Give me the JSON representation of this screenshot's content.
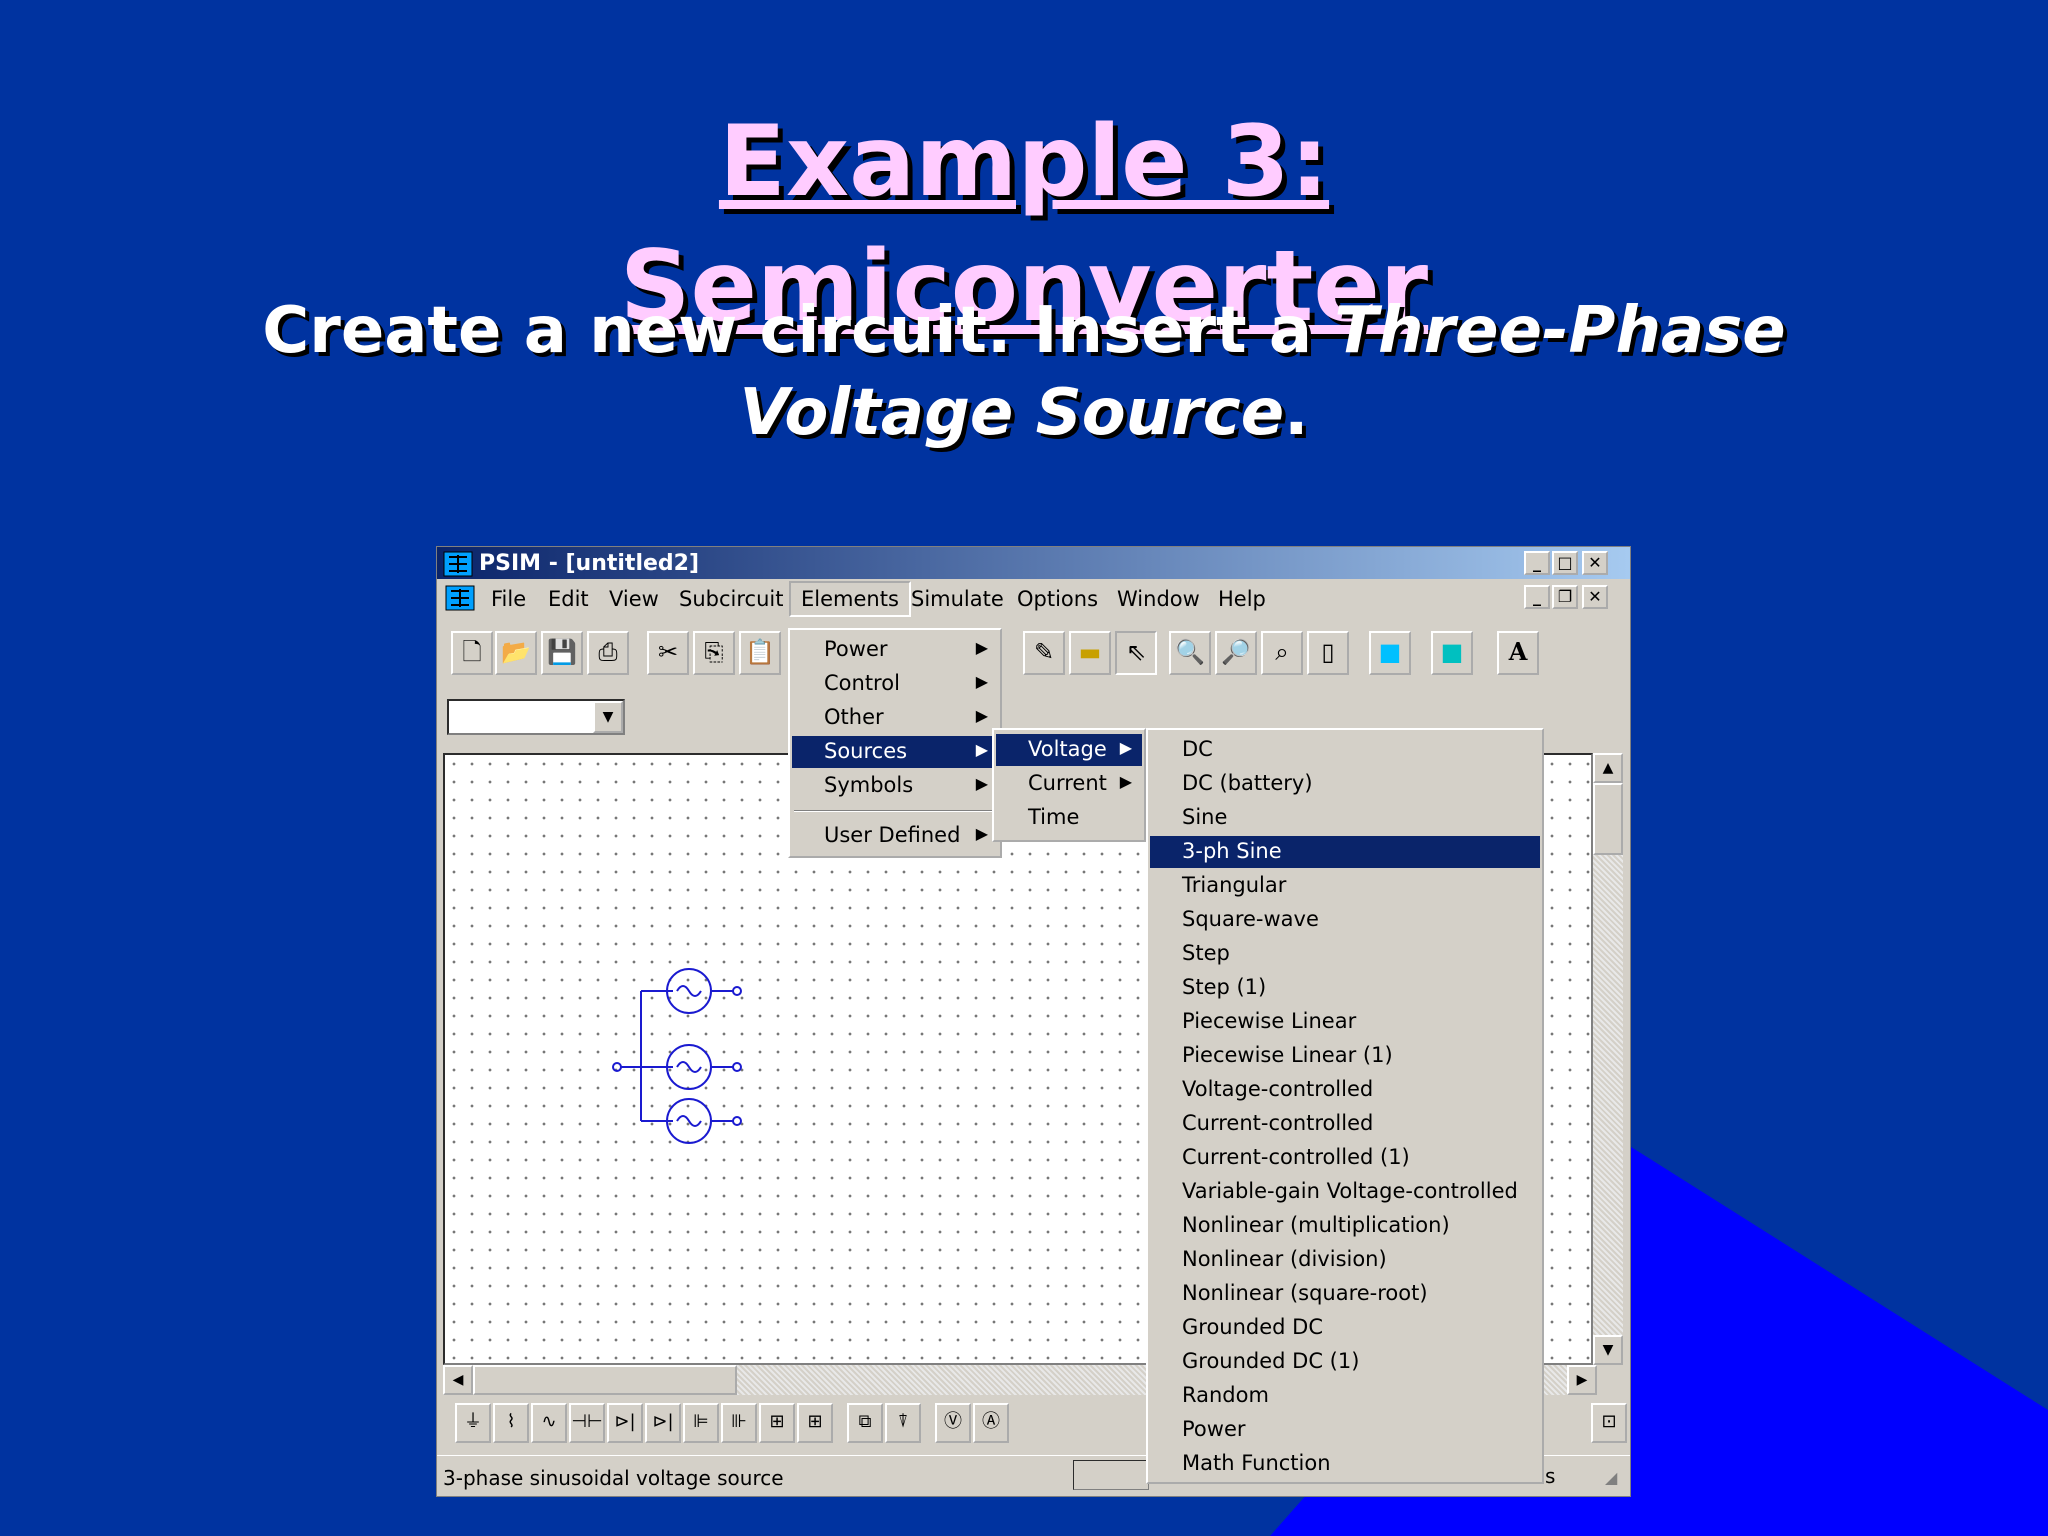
{
  "slide": {
    "title_line1": "Example 3:",
    "title_line2": "Semiconverter",
    "subtitle_part1": "Create a new circuit. Insert a ",
    "subtitle_em1": "Three-Phase",
    "subtitle_em2": "Voltage Source",
    "subtitle_end": "."
  },
  "colors": {
    "slide_bg": "#0033a0",
    "accent_shape": "#0000ff",
    "title": "#ffccff",
    "menu_highlight": "#0a246a"
  },
  "window": {
    "title": "PSIM - [untitled2]",
    "controls": [
      "minimize-icon",
      "maximize-icon",
      "close-icon"
    ],
    "child_controls": [
      "minimize-icon",
      "restore-icon",
      "close-icon"
    ]
  },
  "menubar": {
    "items": [
      "File",
      "Edit",
      "View",
      "Subcircuit",
      "Elements",
      "Simulate",
      "Options",
      "Window",
      "Help"
    ],
    "active": "Elements"
  },
  "toolbar": {
    "icons": [
      "new-icon",
      "open-icon",
      "save-icon",
      "print-icon",
      "cut-icon",
      "copy-icon",
      "paste-icon",
      "wire-icon",
      "label-icon",
      "select-icon",
      "zoom-in-icon",
      "zoom-out-icon",
      "zoom-fit-icon",
      "page-icon",
      "simcoupler-icon",
      "simview-icon",
      "text-icon"
    ],
    "text_button": "A"
  },
  "elements_menu": {
    "items": [
      {
        "label": "Power",
        "submenu": true
      },
      {
        "label": "Control",
        "submenu": true
      },
      {
        "label": "Other",
        "submenu": true
      },
      {
        "label": "Sources",
        "submenu": true,
        "highlighted": true
      },
      {
        "label": "Symbols",
        "submenu": true
      },
      {
        "label": "User Defined",
        "submenu": true
      }
    ]
  },
  "sources_menu": {
    "items": [
      {
        "label": "Voltage",
        "submenu": true,
        "highlighted": true
      },
      {
        "label": "Current",
        "submenu": true
      },
      {
        "label": "Time",
        "submenu": false
      }
    ]
  },
  "voltage_menu": {
    "items": [
      "DC",
      "DC (battery)",
      "Sine",
      "3-ph Sine",
      "Triangular",
      "Square-wave",
      "Step",
      "Step (1)",
      "Piecewise Linear",
      "Piecewise Linear (1)",
      "Voltage-controlled",
      "Current-controlled",
      "Current-controlled (1)",
      "Variable-gain Voltage-controlled",
      "Nonlinear (multiplication)",
      "Nonlinear (division)",
      "Nonlinear (square-root)",
      "Grounded DC",
      "Grounded DC (1)",
      "Random",
      "Power",
      "Math Function"
    ],
    "highlighted": "3-ph Sine"
  },
  "status": {
    "text": "3-phase sinusoidal voltage source",
    "right_fragment": "s"
  },
  "element_bar": {
    "icons": [
      "ground-icon",
      "resistor-icon",
      "inductor-icon",
      "capacitor-icon",
      "diode-icon",
      "thyristor-icon",
      "mosfet-icon",
      "igbt-icon",
      "switch-module-icon",
      "switch-module2-icon",
      "transformer-icon",
      "probe-icon",
      "voltmeter-icon",
      "ammeter-icon",
      "sensor-icon"
    ]
  }
}
